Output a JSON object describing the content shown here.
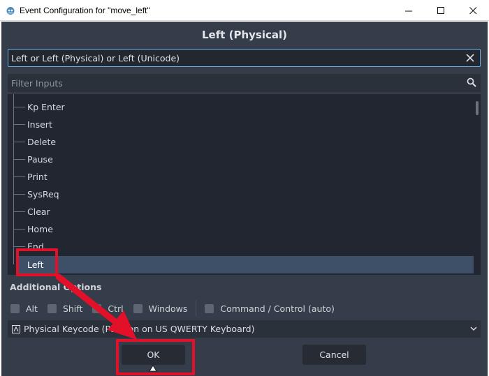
{
  "window": {
    "title": "Event Configuration for \"move_left\"",
    "minimize_icon": "minimize-icon",
    "maximize_icon": "maximize-icon",
    "close_icon": "close-icon"
  },
  "dialog": {
    "heading": "Left (Physical)",
    "event_field": {
      "value": "Left or Left (Physical) or Left (Unicode)",
      "clear_icon": "clear-icon"
    },
    "filter": {
      "placeholder": "Filter Inputs",
      "icon": "search-icon"
    },
    "tree": {
      "items": [
        "Kp Enter",
        "Insert",
        "Delete",
        "Pause",
        "Print",
        "SysReq",
        "Clear",
        "Home",
        "End"
      ],
      "selected": "Left"
    },
    "additional_options": {
      "heading": "Additional Options",
      "modifiers": [
        "Alt",
        "Shift",
        "Ctrl",
        "Windows"
      ],
      "command_modifier": "Command / Control (auto)"
    },
    "keycode_select": {
      "selected": "Physical Keycode (Position on US QWERTY Keyboard)",
      "icon": "keyboard-icon"
    },
    "buttons": {
      "ok": "OK",
      "cancel": "Cancel"
    }
  },
  "colors": {
    "dialog_bg": "#363d4a",
    "panel_bg": "#212630",
    "accent_focus": "#6ab1e6",
    "selection": "#3d5068",
    "annotation_red": "#e3102a"
  }
}
